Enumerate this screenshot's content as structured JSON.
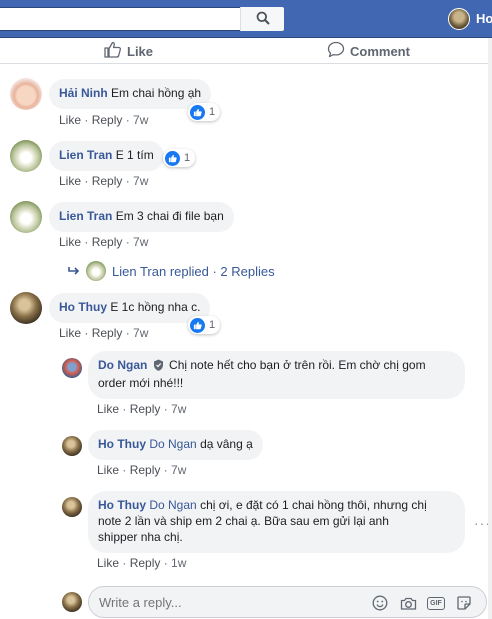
{
  "topbar": {
    "search_placeholder": "",
    "user_name": "Ho",
    "icons": {
      "search": "search-icon"
    }
  },
  "actions": {
    "like_label": "Like",
    "comment_label": "Comment"
  },
  "comments": [
    {
      "author": "Hải Ninh",
      "text": "Em chai hồng ạh",
      "like": "Like",
      "reply": "Reply",
      "time": "7w",
      "reactions": "1"
    },
    {
      "author": "Lien Tran",
      "text": "E 1 tím",
      "like": "Like",
      "reply": "Reply",
      "time": "7w",
      "reactions": "1"
    },
    {
      "author": "Lien Tran",
      "text": "Em 3 chai đi file bạn",
      "like": "Like",
      "reply": "Reply",
      "time": "7w",
      "replied_summary": {
        "author": "Lien Tran",
        "action": "replied",
        "count_text": "2 Replies"
      }
    },
    {
      "author": "Ho Thuy",
      "text": "E 1c hồng nha c.",
      "like": "Like",
      "reply": "Reply",
      "time": "7w",
      "reactions": "1"
    }
  ],
  "replies": [
    {
      "author": "Do Ngan",
      "text_line1": "Chị note hết cho bạn ở trên rồi. Em chờ chị gom",
      "text_line2": "order mới nhé!!!",
      "like": "Like",
      "reply": "Reply",
      "time": "7w"
    },
    {
      "author": "Ho Thuy",
      "mention": "Do Ngan",
      "text": "dạ vâng ạ",
      "like": "Like",
      "reply": "Reply",
      "time": "7w"
    },
    {
      "author": "Ho Thuy",
      "mention": "Do Ngan",
      "text_line1": "chị ơi, e đặt có 1 chai hồng thôi, nhưng chị",
      "text_line2": "note 2 lần và ship em 2 chai ạ. Bữa sau em gửi lại anh",
      "text_line3": "shipper nha chị.",
      "like": "Like",
      "reply": "Reply",
      "time": "1w"
    }
  ],
  "reply_box": {
    "placeholder": "Write a reply...",
    "gif_label": "GIF"
  },
  "colors": {
    "header_blue": "#4267b2",
    "name_blue": "#385898",
    "bubble_bg": "#f2f3f5",
    "like_blue": "#1877f2"
  }
}
